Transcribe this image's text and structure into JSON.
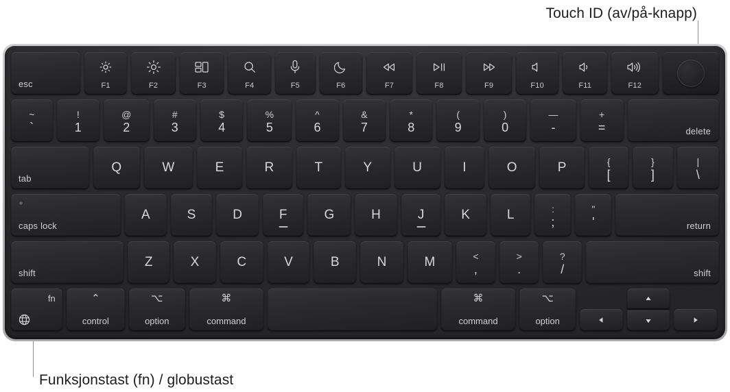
{
  "annotations": {
    "touch_id": "Touch ID (av/på-knapp)",
    "fn_globe": "Funksjonstast (fn) / globustast"
  },
  "colors": {
    "page_background": "#ffffff",
    "chassis_silver": "#bdbec0",
    "deck_dark": "#2b2b2d",
    "key_dark": "#2a2a2d",
    "key_text": "#d6d7d9",
    "leader_line": "#8d8d8d",
    "label_text": "#1d1d1f"
  },
  "keyboard": {
    "layout": "Magic Keyboard with Touch ID (US ANSI)",
    "rows": {
      "function_row": [
        {
          "label": "esc",
          "icon": null,
          "fkey": null,
          "type": "escape"
        },
        {
          "label": null,
          "icon": "brightness-down-icon",
          "fkey": "F1",
          "type": "function"
        },
        {
          "label": null,
          "icon": "brightness-up-icon",
          "fkey": "F2",
          "type": "function"
        },
        {
          "label": null,
          "icon": "mission-control-icon",
          "fkey": "F3",
          "type": "function"
        },
        {
          "label": null,
          "icon": "spotlight-search-icon",
          "fkey": "F4",
          "type": "function"
        },
        {
          "label": null,
          "icon": "dictation-mic-icon",
          "fkey": "F5",
          "type": "function"
        },
        {
          "label": null,
          "icon": "do-not-disturb-moon-icon",
          "fkey": "F6",
          "type": "function"
        },
        {
          "label": null,
          "icon": "rewind-icon",
          "fkey": "F7",
          "type": "function"
        },
        {
          "label": null,
          "icon": "play-pause-icon",
          "fkey": "F8",
          "type": "function"
        },
        {
          "label": null,
          "icon": "fast-forward-icon",
          "fkey": "F9",
          "type": "function"
        },
        {
          "label": null,
          "icon": "volume-mute-icon",
          "fkey": "F10",
          "type": "function"
        },
        {
          "label": null,
          "icon": "volume-down-icon",
          "fkey": "F11",
          "type": "function"
        },
        {
          "label": null,
          "icon": "volume-up-icon",
          "fkey": "F12",
          "type": "function"
        },
        {
          "label": null,
          "icon": "touch-id-icon",
          "fkey": null,
          "type": "touch-id"
        }
      ],
      "number_row": [
        {
          "upper": "~",
          "lower": "`"
        },
        {
          "upper": "!",
          "lower": "1"
        },
        {
          "upper": "@",
          "lower": "2"
        },
        {
          "upper": "#",
          "lower": "3"
        },
        {
          "upper": "$",
          "lower": "4"
        },
        {
          "upper": "%",
          "lower": "5"
        },
        {
          "upper": "^",
          "lower": "6"
        },
        {
          "upper": "&",
          "lower": "7"
        },
        {
          "upper": "*",
          "lower": "8"
        },
        {
          "upper": "(",
          "lower": "9"
        },
        {
          "upper": ")",
          "lower": "0"
        },
        {
          "upper": "—",
          "lower": "-"
        },
        {
          "upper": "+",
          "lower": "="
        },
        {
          "label": "delete"
        }
      ],
      "qwerty_row": [
        {
          "label": "tab"
        },
        {
          "label": "Q"
        },
        {
          "label": "W"
        },
        {
          "label": "E"
        },
        {
          "label": "R"
        },
        {
          "label": "T"
        },
        {
          "label": "Y"
        },
        {
          "label": "U"
        },
        {
          "label": "I"
        },
        {
          "label": "O"
        },
        {
          "label": "P"
        },
        {
          "upper": "{",
          "lower": "["
        },
        {
          "upper": "}",
          "lower": "]"
        },
        {
          "upper": "|",
          "lower": "\\"
        }
      ],
      "home_row": [
        {
          "label": "caps lock"
        },
        {
          "label": "A"
        },
        {
          "label": "S"
        },
        {
          "label": "D"
        },
        {
          "label": "F",
          "bump": true
        },
        {
          "label": "G"
        },
        {
          "label": "H"
        },
        {
          "label": "J",
          "bump": true
        },
        {
          "label": "K"
        },
        {
          "label": "L"
        },
        {
          "upper": ":",
          "lower": ";"
        },
        {
          "upper": "\"",
          "lower": "'"
        },
        {
          "label": "return"
        }
      ],
      "shift_row": [
        {
          "label": "shift"
        },
        {
          "label": "Z"
        },
        {
          "label": "X"
        },
        {
          "label": "C"
        },
        {
          "label": "V"
        },
        {
          "label": "B"
        },
        {
          "label": "N"
        },
        {
          "label": "M"
        },
        {
          "upper": "<",
          "lower": ","
        },
        {
          "upper": ">",
          "lower": "."
        },
        {
          "upper": "?",
          "lower": "/"
        },
        {
          "label": "shift"
        }
      ],
      "bottom_row": [
        {
          "label": "fn",
          "icon": "globe-icon",
          "type": "fn-globe"
        },
        {
          "label": "control",
          "symbol": "⌃"
        },
        {
          "label": "option",
          "symbol": "⌥"
        },
        {
          "label": "command",
          "symbol": "⌘"
        },
        {
          "label": "space",
          "type": "spacebar"
        },
        {
          "label": "command",
          "symbol": "⌘"
        },
        {
          "label": "option",
          "symbol": "⌥"
        },
        {
          "label": "left",
          "icon": "arrow-left-icon",
          "type": "arrow"
        },
        {
          "label": "up",
          "icon": "arrow-up-icon",
          "type": "arrow"
        },
        {
          "label": "down",
          "icon": "arrow-down-icon",
          "type": "arrow"
        },
        {
          "label": "right",
          "icon": "arrow-right-icon",
          "type": "arrow"
        }
      ]
    }
  }
}
